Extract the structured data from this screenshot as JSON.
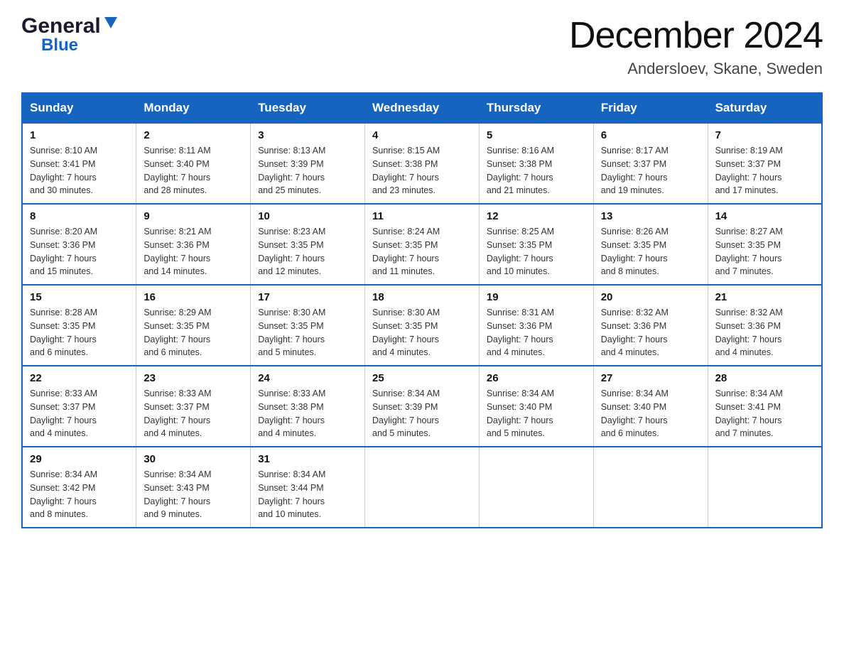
{
  "header": {
    "logo_general": "General",
    "logo_blue": "Blue",
    "month_year": "December 2024",
    "location": "Andersloev, Skane, Sweden"
  },
  "weekdays": [
    "Sunday",
    "Monday",
    "Tuesday",
    "Wednesday",
    "Thursday",
    "Friday",
    "Saturday"
  ],
  "weeks": [
    [
      {
        "day": "1",
        "sunrise": "8:10 AM",
        "sunset": "3:41 PM",
        "daylight": "7 hours and 30 minutes."
      },
      {
        "day": "2",
        "sunrise": "8:11 AM",
        "sunset": "3:40 PM",
        "daylight": "7 hours and 28 minutes."
      },
      {
        "day": "3",
        "sunrise": "8:13 AM",
        "sunset": "3:39 PM",
        "daylight": "7 hours and 25 minutes."
      },
      {
        "day": "4",
        "sunrise": "8:15 AM",
        "sunset": "3:38 PM",
        "daylight": "7 hours and 23 minutes."
      },
      {
        "day": "5",
        "sunrise": "8:16 AM",
        "sunset": "3:38 PM",
        "daylight": "7 hours and 21 minutes."
      },
      {
        "day": "6",
        "sunrise": "8:17 AM",
        "sunset": "3:37 PM",
        "daylight": "7 hours and 19 minutes."
      },
      {
        "day": "7",
        "sunrise": "8:19 AM",
        "sunset": "3:37 PM",
        "daylight": "7 hours and 17 minutes."
      }
    ],
    [
      {
        "day": "8",
        "sunrise": "8:20 AM",
        "sunset": "3:36 PM",
        "daylight": "7 hours and 15 minutes."
      },
      {
        "day": "9",
        "sunrise": "8:21 AM",
        "sunset": "3:36 PM",
        "daylight": "7 hours and 14 minutes."
      },
      {
        "day": "10",
        "sunrise": "8:23 AM",
        "sunset": "3:35 PM",
        "daylight": "7 hours and 12 minutes."
      },
      {
        "day": "11",
        "sunrise": "8:24 AM",
        "sunset": "3:35 PM",
        "daylight": "7 hours and 11 minutes."
      },
      {
        "day": "12",
        "sunrise": "8:25 AM",
        "sunset": "3:35 PM",
        "daylight": "7 hours and 10 minutes."
      },
      {
        "day": "13",
        "sunrise": "8:26 AM",
        "sunset": "3:35 PM",
        "daylight": "7 hours and 8 minutes."
      },
      {
        "day": "14",
        "sunrise": "8:27 AM",
        "sunset": "3:35 PM",
        "daylight": "7 hours and 7 minutes."
      }
    ],
    [
      {
        "day": "15",
        "sunrise": "8:28 AM",
        "sunset": "3:35 PM",
        "daylight": "7 hours and 6 minutes."
      },
      {
        "day": "16",
        "sunrise": "8:29 AM",
        "sunset": "3:35 PM",
        "daylight": "7 hours and 6 minutes."
      },
      {
        "day": "17",
        "sunrise": "8:30 AM",
        "sunset": "3:35 PM",
        "daylight": "7 hours and 5 minutes."
      },
      {
        "day": "18",
        "sunrise": "8:30 AM",
        "sunset": "3:35 PM",
        "daylight": "7 hours and 4 minutes."
      },
      {
        "day": "19",
        "sunrise": "8:31 AM",
        "sunset": "3:36 PM",
        "daylight": "7 hours and 4 minutes."
      },
      {
        "day": "20",
        "sunrise": "8:32 AM",
        "sunset": "3:36 PM",
        "daylight": "7 hours and 4 minutes."
      },
      {
        "day": "21",
        "sunrise": "8:32 AM",
        "sunset": "3:36 PM",
        "daylight": "7 hours and 4 minutes."
      }
    ],
    [
      {
        "day": "22",
        "sunrise": "8:33 AM",
        "sunset": "3:37 PM",
        "daylight": "7 hours and 4 minutes."
      },
      {
        "day": "23",
        "sunrise": "8:33 AM",
        "sunset": "3:37 PM",
        "daylight": "7 hours and 4 minutes."
      },
      {
        "day": "24",
        "sunrise": "8:33 AM",
        "sunset": "3:38 PM",
        "daylight": "7 hours and 4 minutes."
      },
      {
        "day": "25",
        "sunrise": "8:34 AM",
        "sunset": "3:39 PM",
        "daylight": "7 hours and 5 minutes."
      },
      {
        "day": "26",
        "sunrise": "8:34 AM",
        "sunset": "3:40 PM",
        "daylight": "7 hours and 5 minutes."
      },
      {
        "day": "27",
        "sunrise": "8:34 AM",
        "sunset": "3:40 PM",
        "daylight": "7 hours and 6 minutes."
      },
      {
        "day": "28",
        "sunrise": "8:34 AM",
        "sunset": "3:41 PM",
        "daylight": "7 hours and 7 minutes."
      }
    ],
    [
      {
        "day": "29",
        "sunrise": "8:34 AM",
        "sunset": "3:42 PM",
        "daylight": "7 hours and 8 minutes."
      },
      {
        "day": "30",
        "sunrise": "8:34 AM",
        "sunset": "3:43 PM",
        "daylight": "7 hours and 9 minutes."
      },
      {
        "day": "31",
        "sunrise": "8:34 AM",
        "sunset": "3:44 PM",
        "daylight": "7 hours and 10 minutes."
      },
      null,
      null,
      null,
      null
    ]
  ],
  "labels": {
    "sunrise": "Sunrise:",
    "sunset": "Sunset:",
    "daylight": "Daylight:"
  }
}
